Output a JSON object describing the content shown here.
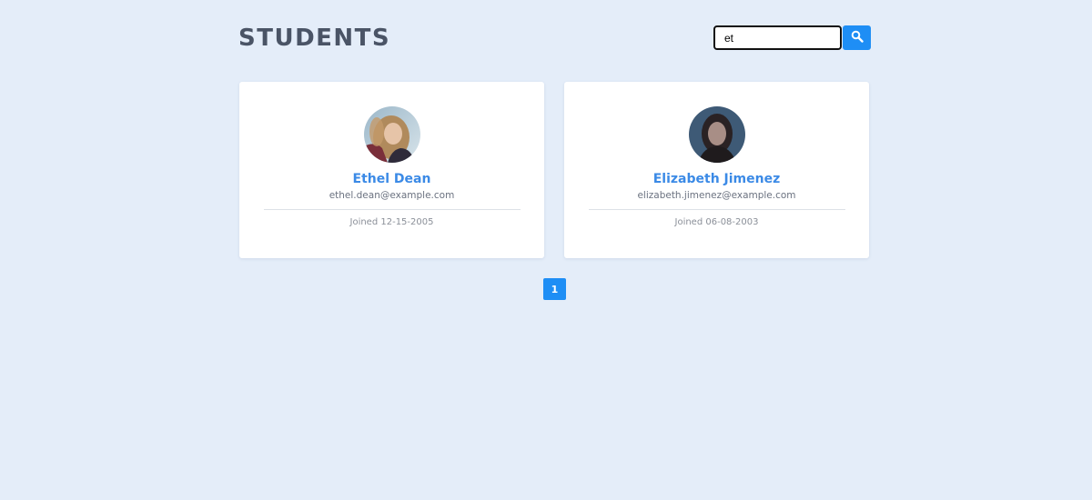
{
  "header": {
    "title": "STUDENTS"
  },
  "search": {
    "value": "et",
    "icon": "search-icon"
  },
  "students": [
    {
      "name": "Ethel Dean",
      "email": "ethel.dean@example.com",
      "joined": "Joined 12-15-2005"
    },
    {
      "name": "Elizabeth Jimenez",
      "email": "elizabeth.jimenez@example.com",
      "joined": "Joined 06-08-2003"
    }
  ],
  "pagination": {
    "pages": [
      "1"
    ],
    "current": "1"
  },
  "colors": {
    "background": "#e4edf9",
    "accent": "#1e8ef5",
    "name": "#3b8ae6",
    "title": "#4a5466"
  }
}
